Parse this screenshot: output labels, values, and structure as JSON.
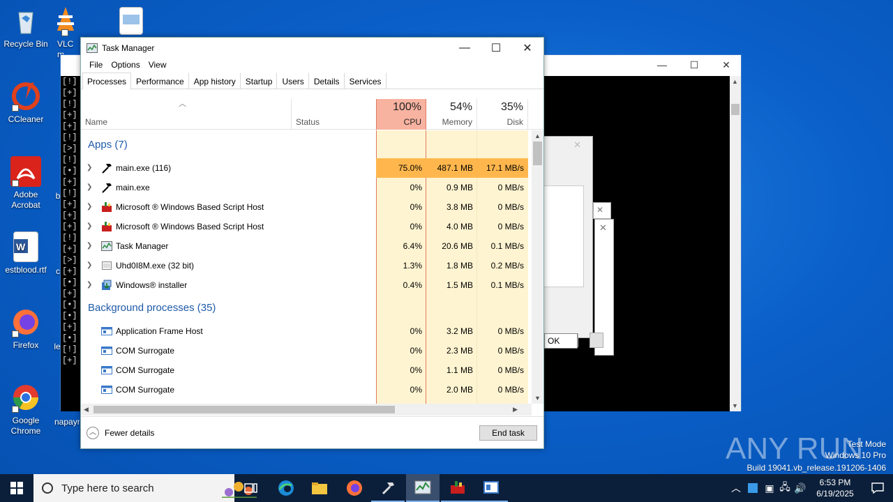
{
  "desktop": {
    "icons": [
      {
        "label": "Recycle Bin"
      },
      {
        "label": "VLC m"
      },
      {
        "label": "CCleaner"
      },
      {
        "label": "Adobe Acrobat"
      },
      {
        "label": "b"
      },
      {
        "label": "estblood.rtf"
      },
      {
        "label": "c"
      },
      {
        "label": "Firefox"
      },
      {
        "label": "le"
      },
      {
        "label": "Google Chrome"
      },
      {
        "label": "napayr"
      }
    ]
  },
  "console": {
    "lines": [
      "[!]",
      "[+]",
      "[!]",
      "[+]",
      "[+]",
      "[!]",
      "[>]",
      "[!]",
      "[•]",
      "[+]",
      "[!]",
      "[+]",
      "[+]",
      "[+]",
      "[!]",
      "[+]",
      "[>]",
      "[+]",
      "[•]",
      "[+]",
      "[•]",
      "[•]",
      "[+]",
      "[•]",
      "[!]",
      "[+]"
    ],
    "ok_label": "OK"
  },
  "taskmanager": {
    "title": "Task Manager",
    "menu": [
      "File",
      "Options",
      "View"
    ],
    "tabs": [
      "Processes",
      "Performance",
      "App history",
      "Startup",
      "Users",
      "Details",
      "Services"
    ],
    "active_tab": "Processes",
    "columns": {
      "name": "Name",
      "status": "Status",
      "cpu_pct": "100%",
      "cpu": "CPU",
      "mem_pct": "54%",
      "mem": "Memory",
      "disk_pct": "35%",
      "disk": "Disk"
    },
    "apps_group": "Apps (7)",
    "bg_group": "Background processes (35)",
    "apps": [
      {
        "name": "main.exe (116)",
        "cpu": "75.0%",
        "mem": "487.1 MB",
        "disk": "17.1 MB/s",
        "icon": "hammer-icon"
      },
      {
        "name": "main.exe",
        "cpu": "0%",
        "mem": "0.9 MB",
        "disk": "0 MB/s",
        "icon": "hammer-icon"
      },
      {
        "name": "Microsoft ® Windows Based Script Host",
        "cpu": "0%",
        "mem": "3.8 MB",
        "disk": "0 MB/s",
        "icon": "script-host-icon"
      },
      {
        "name": "Microsoft ® Windows Based Script Host",
        "cpu": "0%",
        "mem": "4.0 MB",
        "disk": "0 MB/s",
        "icon": "script-host-icon"
      },
      {
        "name": "Task Manager",
        "cpu": "6.4%",
        "mem": "20.6 MB",
        "disk": "0.1 MB/s",
        "icon": "task-manager-icon"
      },
      {
        "name": "Uhd0I8M.exe (32 bit)",
        "cpu": "1.3%",
        "mem": "1.8 MB",
        "disk": "0.2 MB/s",
        "icon": "exe-icon"
      },
      {
        "name": "Windows® installer",
        "cpu": "0.4%",
        "mem": "1.5 MB",
        "disk": "0.1 MB/s",
        "icon": "installer-icon"
      }
    ],
    "background": [
      {
        "name": "Application Frame Host",
        "cpu": "0%",
        "mem": "3.2 MB",
        "disk": "0 MB/s",
        "icon": "window-icon"
      },
      {
        "name": "COM Surrogate",
        "cpu": "0%",
        "mem": "2.3 MB",
        "disk": "0 MB/s",
        "icon": "window-icon"
      },
      {
        "name": "COM Surrogate",
        "cpu": "0%",
        "mem": "1.1 MB",
        "disk": "0 MB/s",
        "icon": "window-icon"
      },
      {
        "name": "COM Surrogate",
        "cpu": "0%",
        "mem": "2.0 MB",
        "disk": "0 MB/s",
        "icon": "window-icon"
      }
    ],
    "fewer_details": "Fewer details",
    "end_task": "End task"
  },
  "watermark": {
    "brand": "ANY RUN",
    "mode": "Test Mode",
    "edition": "Windows 10 Pro",
    "build": "Build 19041.vb_release.191206-1406"
  },
  "taskbar": {
    "search_placeholder": "Type here to search",
    "time": "6:53 PM",
    "date": "6/19/2025"
  },
  "colors": {
    "cpu_hot": "#ffb74d",
    "cpu_warm": "#fff0c2",
    "cpu_light": "#fff4d1",
    "cpu_header": "#f8b2a0",
    "cpu_border": "#e07a5f",
    "group_blue": "#1e5aa8"
  }
}
